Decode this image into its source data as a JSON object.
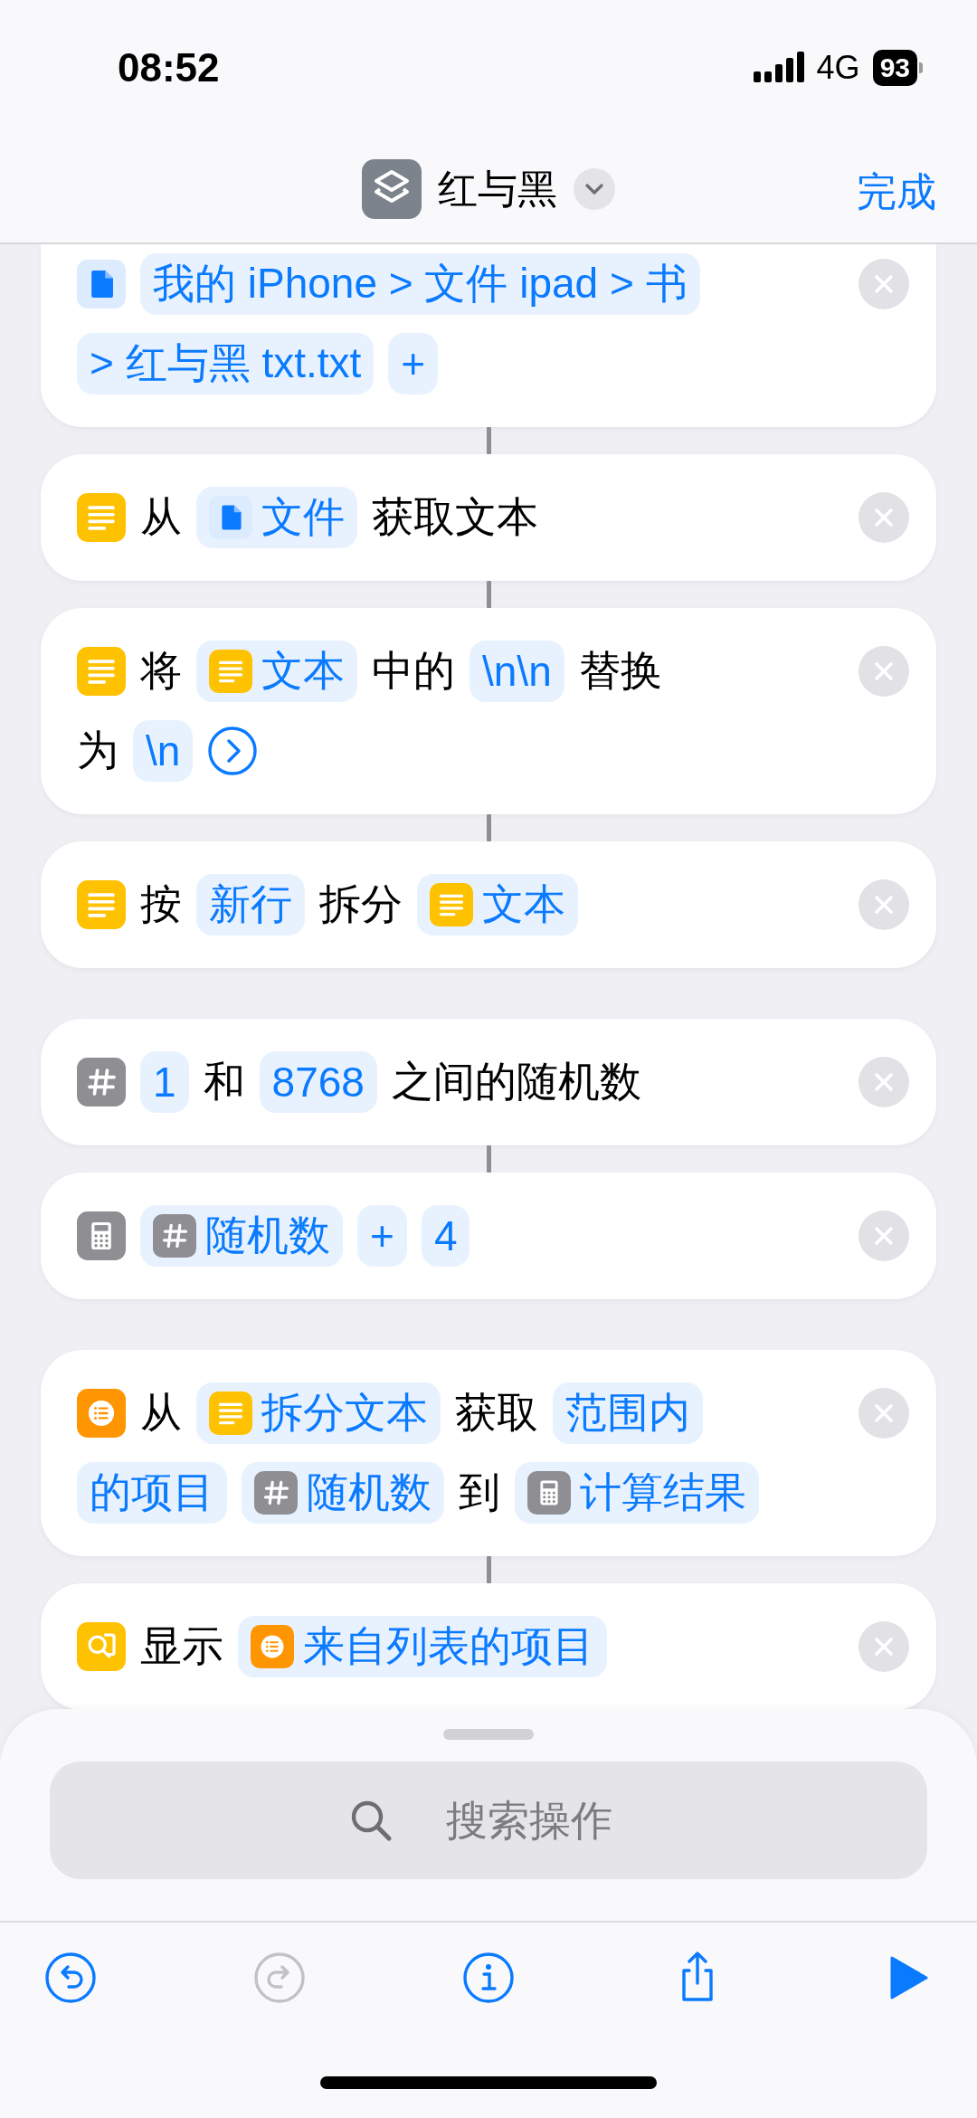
{
  "status_bar": {
    "time": "08:52",
    "network": "4G",
    "battery": "93"
  },
  "nav": {
    "title": "红与黑",
    "done": "完成"
  },
  "actions": [
    {
      "kind": "file",
      "linked_above": false,
      "lines": [
        [
          {
            "kind": "token",
            "text": "我的 iPhone > 文件 ipad > 书"
          }
        ],
        [
          {
            "kind": "token",
            "text": "> 红与黑 txt.txt"
          },
          {
            "kind": "token",
            "text": "+"
          }
        ]
      ]
    },
    {
      "kind": "text",
      "linked_above": true,
      "lines": [
        [
          {
            "kind": "text",
            "text": "从"
          },
          {
            "kind": "file_token",
            "text": "文件"
          },
          {
            "kind": "text",
            "text": "获取文本"
          }
        ]
      ]
    },
    {
      "kind": "text",
      "linked_above": true,
      "lines": [
        [
          {
            "kind": "text",
            "text": "将"
          },
          {
            "kind": "text_token",
            "text": "文本"
          },
          {
            "kind": "text",
            "text": "中的"
          },
          {
            "kind": "token",
            "text": "\\n\\n"
          },
          {
            "kind": "text",
            "text": "替换"
          }
        ],
        [
          {
            "kind": "text",
            "text": "为"
          },
          {
            "kind": "token",
            "text": "\\n"
          },
          {
            "kind": "expand"
          }
        ]
      ]
    },
    {
      "kind": "text",
      "linked_above": true,
      "lines": [
        [
          {
            "kind": "text",
            "text": "按"
          },
          {
            "kind": "token",
            "text": "新行"
          },
          {
            "kind": "text",
            "text": "拆分"
          },
          {
            "kind": "text_token",
            "text": "文本"
          }
        ]
      ]
    },
    {
      "kind": "number",
      "linked_above": false,
      "lines": [
        [
          {
            "kind": "token",
            "text": "1"
          },
          {
            "kind": "text",
            "text": "和"
          },
          {
            "kind": "token",
            "text": "8768"
          },
          {
            "kind": "text",
            "text": "之间的随机数"
          }
        ]
      ]
    },
    {
      "kind": "calculator",
      "linked_above": true,
      "lines": [
        [
          {
            "kind": "number_token",
            "text": "随机数"
          },
          {
            "kind": "token",
            "text": "+"
          },
          {
            "kind": "token",
            "text": "4"
          }
        ]
      ]
    },
    {
      "kind": "list",
      "linked_above": false,
      "lines": [
        [
          {
            "kind": "text",
            "text": "从"
          },
          {
            "kind": "text_token",
            "text": "拆分文本"
          },
          {
            "kind": "text",
            "text": "获取"
          },
          {
            "kind": "token",
            "text": "范围内"
          }
        ],
        [
          {
            "kind": "token",
            "text": "的项目"
          },
          {
            "kind": "number_token",
            "text": "随机数"
          },
          {
            "kind": "text",
            "text": "到"
          },
          {
            "kind": "calculator_token",
            "text": "计算结果"
          }
        ]
      ]
    },
    {
      "kind": "show",
      "linked_above": true,
      "lines": [
        [
          {
            "kind": "text",
            "text": "显示"
          },
          {
            "kind": "list_token",
            "text": "来自列表的项目"
          }
        ]
      ]
    }
  ],
  "search": {
    "placeholder": "搜索操作"
  },
  "toolbar": [
    {
      "kind": "undo",
      "disabled": false
    },
    {
      "kind": "redo",
      "disabled": true
    },
    {
      "kind": "info",
      "disabled": false
    },
    {
      "kind": "share",
      "disabled": false
    },
    {
      "kind": "run",
      "disabled": false
    }
  ]
}
